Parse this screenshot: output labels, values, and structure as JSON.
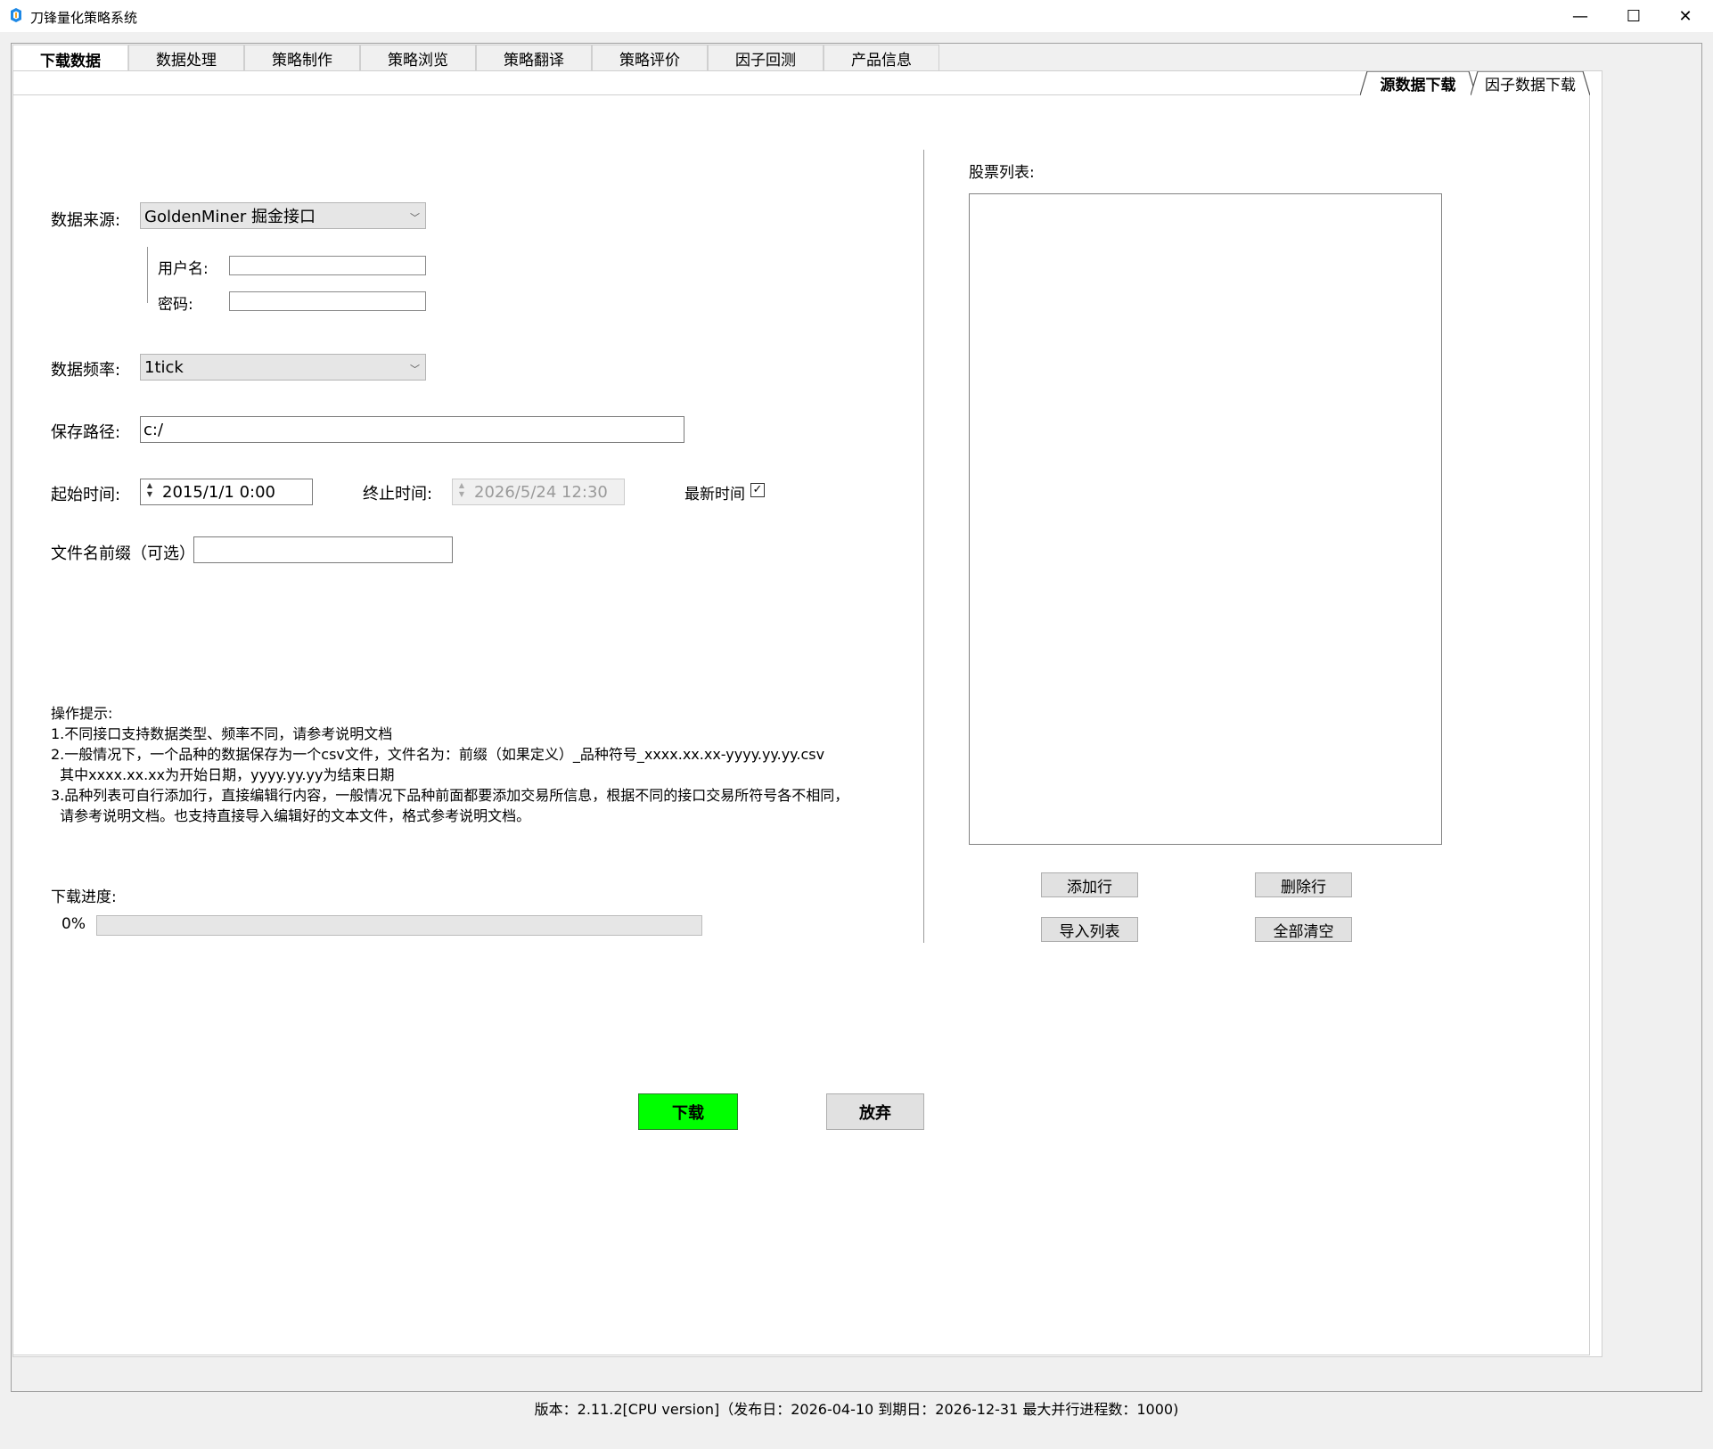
{
  "window": {
    "title": "刀锋量化策略系统",
    "minimize": "—",
    "maximize": "☐",
    "close": "✕"
  },
  "main_tabs": [
    {
      "label": "下载数据",
      "active": true
    },
    {
      "label": "数据处理",
      "active": false
    },
    {
      "label": "策略制作",
      "active": false
    },
    {
      "label": "策略浏览",
      "active": false
    },
    {
      "label": "策略翻译",
      "active": false
    },
    {
      "label": "策略评价",
      "active": false
    },
    {
      "label": "因子回测",
      "active": false
    },
    {
      "label": "产品信息",
      "active": false
    }
  ],
  "sub_tabs": [
    {
      "label": "源数据下载",
      "active": true
    },
    {
      "label": "因子数据下载",
      "active": false
    }
  ],
  "form": {
    "source_label": "数据来源:",
    "source_value": "GoldenMiner 掘金接口",
    "username_label": "用户名:",
    "username_value": "",
    "password_label": "密码:",
    "password_value": "",
    "freq_label": "数据频率:",
    "freq_value": "1tick",
    "path_label": "保存路径:",
    "path_value": "c:/",
    "start_label": "起始时间:",
    "start_value": "2015/1/1 0:00",
    "end_label": "终止时间:",
    "end_value": "2026/5/24 12:30",
    "latest_label": "最新时间",
    "latest_checked": true,
    "prefix_label": "文件名前缀（可选）",
    "prefix_value": ""
  },
  "hints": {
    "title": "操作提示:",
    "lines": [
      "1.不同接口支持数据类型、频率不同，请参考说明文档",
      "2.一般情况下，一个品种的数据保存为一个csv文件，文件名为：前缀（如果定义）_品种符号_xxxx.xx.xx-yyyy.yy.yy.csv",
      "  其中xxxx.xx.xx为开始日期，yyyy.yy.yy为结束日期",
      "3.品种列表可自行添加行，直接编辑行内容，一般情况下品种前面都要添加交易所信息，根据不同的接口交易所符号各不相同，",
      "  请参考说明文档。也支持直接导入编辑好的文本文件，格式参考说明文档。"
    ]
  },
  "progress": {
    "label": "下载进度:",
    "percent_text": "0%",
    "value": 0
  },
  "stock_list": {
    "label": "股票列表:",
    "items": [],
    "add_row": "添加行",
    "delete_row": "删除行",
    "import_list": "导入列表",
    "clear_all": "全部清空"
  },
  "actions": {
    "download": "下载",
    "abandon": "放弃"
  },
  "status_bar": "版本：2.11.2[CPU version]（发布日：2026-04-10  到期日：2026-12-31  最大并行进程数：1000)",
  "colors": {
    "download_button": "#00ff00",
    "app_icon_primary": "#1e88e5",
    "app_icon_secondary": "#f9a825"
  }
}
